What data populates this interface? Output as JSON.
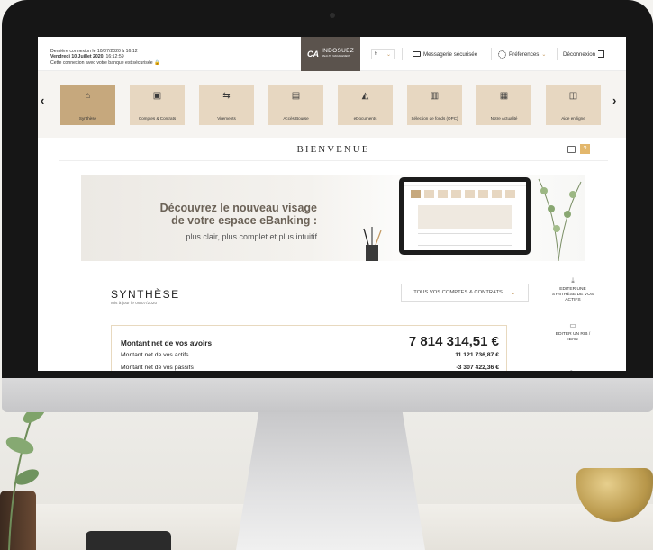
{
  "header": {
    "login_line1": "Dernière connexion le 10/07/2020 à 16:12",
    "login_line2_date": "Vendredi 10 Juillet 2020,",
    "login_line2_time": "16:12:59",
    "login_line3": "Cette connexion avec votre banque est sécurisée",
    "brand": "INDOSUEZ",
    "brand_mark": "CA",
    "brand_sub": "WEALTH MANAGEMENT",
    "language": "fr",
    "messaging": "Messagerie sécurisée",
    "preferences": "Préférences",
    "logout": "Déconnexion"
  },
  "nav": {
    "items": [
      {
        "label": "Synthèse",
        "icon": "home-icon",
        "active": true
      },
      {
        "label": "Comptes & Contrats",
        "icon": "wallet-icon",
        "active": false
      },
      {
        "label": "Virements",
        "icon": "transfer-icon",
        "active": false
      },
      {
        "label": "Accès Bourse",
        "icon": "clipboard-icon",
        "active": false
      },
      {
        "label": "eDocuments",
        "icon": "tray-icon",
        "active": false
      },
      {
        "label": "Sélection de fonds (OPC)",
        "icon": "opc-icon",
        "active": false
      },
      {
        "label": "Notre Actualité",
        "icon": "news-icon",
        "active": false
      },
      {
        "label": "Aide en ligne",
        "icon": "help-icon",
        "active": false
      }
    ]
  },
  "page": {
    "welcome": "BIENVENUE",
    "help_label": "?"
  },
  "banner": {
    "line1": "Découvrez le nouveau visage",
    "line2": "de votre espace eBanking :",
    "line3": "plus clair, plus complet et plus intuitif"
  },
  "synthesis": {
    "title": "SYNTHÈSE",
    "updated": "Mis à jour le 09/07/2020",
    "select_label": "TOUS VOS COMPTES & CONTRATS",
    "rows": {
      "total_label": "Montant net de vos avoirs",
      "total_value": "7 814 314,51 €",
      "assets_label": "Montant net de vos actifs",
      "assets_value": "11 121 736,87 €",
      "liabilities_label": "Montant net de vos passifs",
      "liabilities_value": "-3 307 422,36 €"
    }
  },
  "side_actions": {
    "export_synthesis": "EDITER UNE SYNTHÈSE DE VOS ACTIFS",
    "export_rib": "EDITER UN RIB / IBAN"
  },
  "colors": {
    "brand_dark": "#5b534d",
    "accent_gold": "#c49a63",
    "nav_tile": "#e7d7c1",
    "nav_tile_active": "#c6a87d"
  }
}
